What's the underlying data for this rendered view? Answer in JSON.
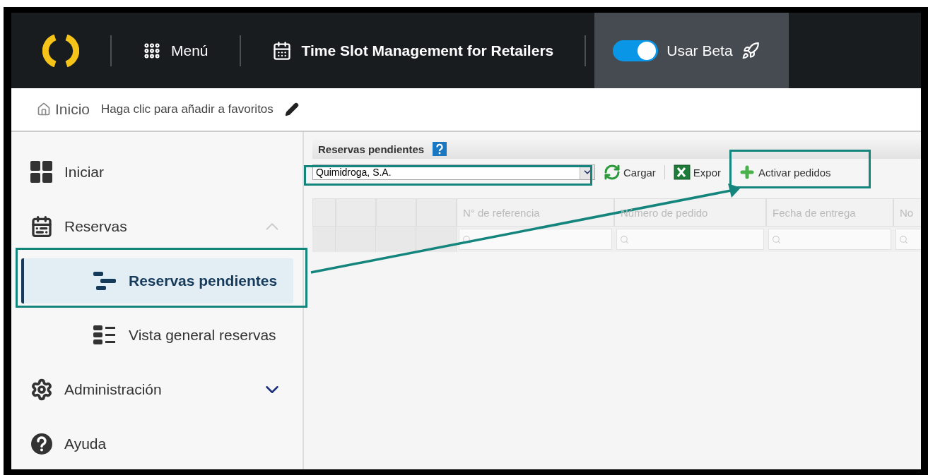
{
  "app_bar": {
    "menu_label": "Menú",
    "title": "Time Slot Management for Retailers",
    "beta_toggle": {
      "label": "Usar Beta",
      "on": true
    }
  },
  "breadcrumb": {
    "home": "Inicio",
    "favorite_hint": "Haga clic para añadir a favoritos"
  },
  "sidebar": {
    "items": [
      {
        "label": "Iniciar"
      },
      {
        "label": "Reservas",
        "expanded": true,
        "children": [
          {
            "label": "Reservas pendientes",
            "selected": true
          },
          {
            "label": "Vista general reservas",
            "selected": false
          }
        ]
      },
      {
        "label": "Administración",
        "expanded": false
      },
      {
        "label": "Ayuda"
      }
    ]
  },
  "panel": {
    "title": "Reservas pendientes",
    "customer_select": {
      "value": "Quimidroga, S.A."
    },
    "toolbar": [
      {
        "label": "Cargar"
      },
      {
        "label": "Expor"
      },
      {
        "label": "Activar pedidos"
      }
    ],
    "table": {
      "columns": [
        {
          "label": "N° de referencia"
        },
        {
          "label": "Número de pedido"
        },
        {
          "label": "Fecha de entrega"
        },
        {
          "label": "No"
        }
      ]
    }
  }
}
